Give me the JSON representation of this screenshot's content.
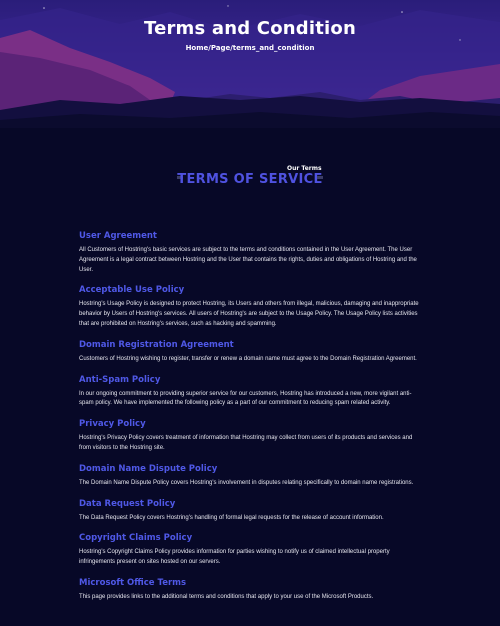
{
  "header": {
    "title": "Terms and Condition",
    "breadcrumb": "Home/Page/terms_and_condition"
  },
  "section": {
    "eyebrow": "Our Terms",
    "title": "TERMS OF SERVICE"
  },
  "terms": [
    {
      "heading": "User Agreement",
      "text": "All Customers of Hostring's basic services are subject to the terms and conditions contained in the User Agreement. The User Agreement is a legal contract between Hostring and the User that contains the rights, duties and obligations of Hostring and the User."
    },
    {
      "heading": "Acceptable Use Policy",
      "text": "Hostring's Usage Policy is designed to protect Hostring, its Users and others from illegal, malicious, damaging and inappropriate behavior by Users of Hostring's services. All users of Hostring's are subject to the Usage Policy. The Usage Policy lists activities that are prohibited on Hostring's services, such as hacking and spamming."
    },
    {
      "heading": "Domain Registration Agreement",
      "text": "Customers of Hostring wishing to register, transfer or renew a domain name must agree to the Domain Registration Agreement."
    },
    {
      "heading": "Anti-Spam Policy",
      "text": "In our ongoing commitment to providing superior service for our customers, Hostring has introduced a new, more vigilant anti-spam policy. We have implemented the following policy as a part of our commitment to reducing spam related activity."
    },
    {
      "heading": "Privacy Policy",
      "text": "Hostring's Privacy Policy covers treatment of information that Hostring may collect from users of its products and services and from visitors to the Hostring site."
    },
    {
      "heading": "Domain Name Dispute Policy",
      "text": "The Domain Name Dispute Policy covers Hostring's involvement in disputes relating specifically to domain name registrations."
    },
    {
      "heading": "Data Request Policy",
      "text": "The Data Request Policy covers Hostring's handling of formal legal requests for the release of account information."
    },
    {
      "heading": "Copyright Claims Policy",
      "text": "Hostring's Copyright Claims Policy provides information for parties wishing to notify us of claimed intellectual property infringements present on sites hosted on our servers."
    },
    {
      "heading": "Microsoft Office Terms",
      "text": "This page provides links to the additional terms and conditions that apply to your use of the Microsoft Products."
    }
  ],
  "colors": {
    "background": "#070827",
    "accent": "#4f58e6",
    "hero_purple": "#3a2590",
    "mountain_magenta": "#7a2f86"
  }
}
